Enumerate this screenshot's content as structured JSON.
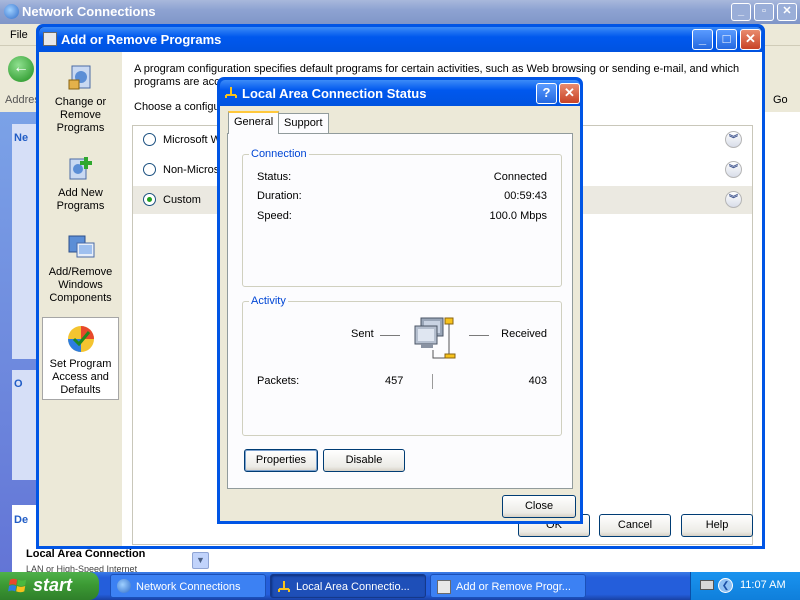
{
  "network_connections": {
    "title": "Network Connections",
    "menu_file": "File",
    "address_label": "Address",
    "go_label": "Go",
    "sidebar": {
      "section1_header": "Ne",
      "section2_header": "O",
      "details_header": "De",
      "details_title": "Local Area Connection",
      "details_subtitle": "LAN or High-Speed Internet"
    }
  },
  "add_remove_programs": {
    "title": "Add or Remove Programs",
    "nav": [
      {
        "label": "Change or Remove Programs",
        "icon": "change-remove-programs-icon"
      },
      {
        "label": "Add New Programs",
        "icon": "add-new-programs-icon"
      },
      {
        "label": "Add/Remove Windows Components",
        "icon": "windows-components-icon"
      },
      {
        "label": "Set Program Access and Defaults",
        "icon": "program-access-defaults-icon"
      }
    ],
    "description": "A program configuration specifies default programs for certain activities, such as Web browsing or sending e-mail, and which programs are accessible from the Start menu, desktop, and other locations.",
    "choose_label": "Choose a configuration:",
    "configurations": [
      {
        "label": "Microsoft Windows",
        "selected": false
      },
      {
        "label": "Non-Microsoft",
        "selected": false
      },
      {
        "label": "Custom",
        "selected": true
      }
    ],
    "buttons": {
      "ok": "OK",
      "cancel": "Cancel",
      "help": "Help"
    }
  },
  "lac_status": {
    "title": "Local Area Connection Status",
    "tabs": [
      "General",
      "Support"
    ],
    "connection": {
      "header": "Connection",
      "status_label": "Status:",
      "status_value": "Connected",
      "duration_label": "Duration:",
      "duration_value": "00:59:43",
      "speed_label": "Speed:",
      "speed_value": "100.0 Mbps"
    },
    "activity": {
      "header": "Activity",
      "sent_label": "Sent",
      "received_label": "Received",
      "packets_label": "Packets:",
      "packets_sent": "457",
      "packets_received": "403"
    },
    "buttons": {
      "properties": "Properties",
      "disable": "Disable",
      "close": "Close"
    }
  },
  "taskbar": {
    "start_label": "start",
    "tasks": [
      {
        "label": "Network Connections",
        "active": false
      },
      {
        "label": "Local Area Connectio...",
        "active": true
      },
      {
        "label": "Add or Remove Progr...",
        "active": false
      }
    ],
    "clock": "11:07 AM"
  },
  "colors": {
    "xp_blue": "#0055e5",
    "taskbar_blue": "#245edb",
    "start_green": "#3c9a34",
    "group_title": "#0046d5"
  }
}
